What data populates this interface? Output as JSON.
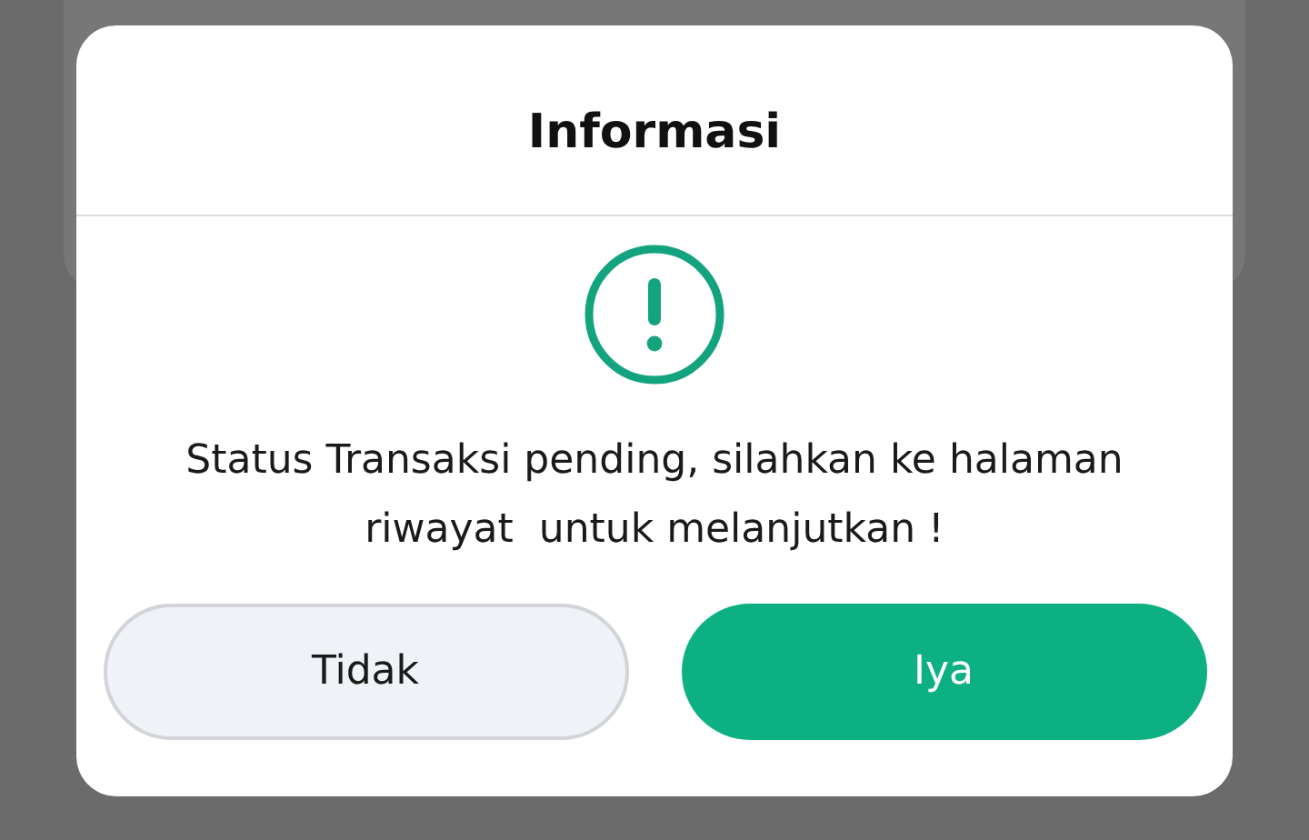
{
  "dialog": {
    "title": "Informasi",
    "message": "Status Transaksi pending, silahkan ke halaman riwayat  untuk melanjutkan !",
    "buttons": [
      {
        "label": "Tidak",
        "kind": "secondary"
      },
      {
        "label": "Iya",
        "kind": "primary"
      }
    ]
  }
}
